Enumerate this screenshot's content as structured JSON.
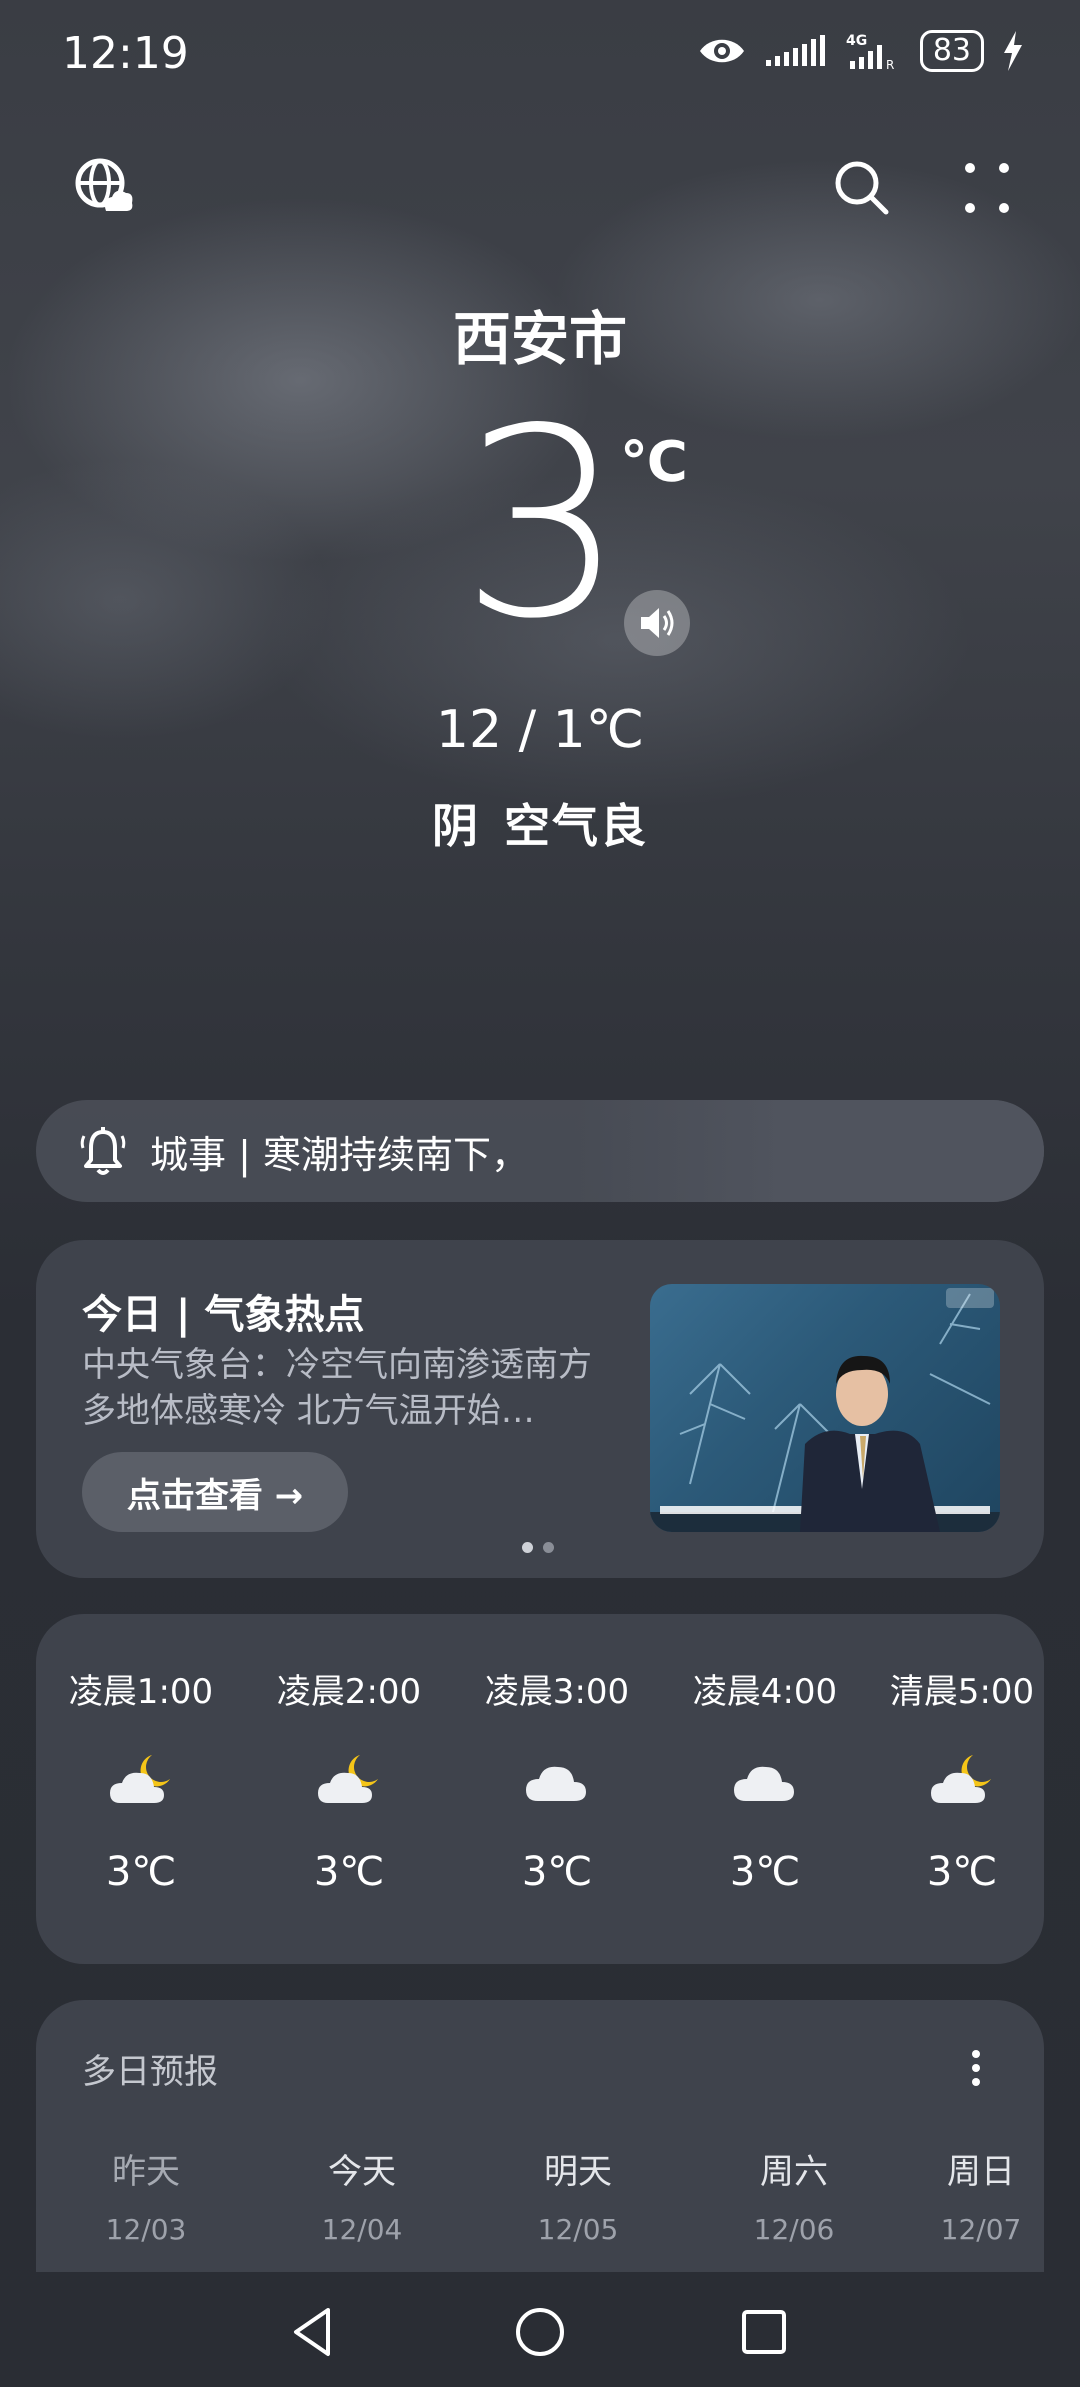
{
  "status_bar": {
    "time": "12:19",
    "battery": "83",
    "network": "4G"
  },
  "header": {
    "city": "西安市",
    "temperature": "3",
    "unit": "℃",
    "range": "12 / 1℃",
    "condition": "阴",
    "air_quality": "空气良"
  },
  "alert": {
    "text": "城事 | 寒潮持续南下，"
  },
  "news": {
    "title": "今日 | 气象热点",
    "description": "中央气象台：冷空气向南渗透南方多地体感寒冷 北方气温开始…",
    "button_label": "点击查看 →",
    "page_count": 2,
    "active_page": 1
  },
  "hourly": [
    {
      "time": "凌晨1:00",
      "icon": "moon-cloud-icon",
      "temp": "3℃"
    },
    {
      "time": "凌晨2:00",
      "icon": "moon-cloud-icon",
      "temp": "3℃"
    },
    {
      "time": "凌晨3:00",
      "icon": "cloud-icon",
      "temp": "3℃"
    },
    {
      "time": "凌晨4:00",
      "icon": "cloud-icon",
      "temp": "3℃"
    },
    {
      "time": "清晨5:00",
      "icon": "moon-cloud-icon",
      "temp": "3℃"
    }
  ],
  "daily": {
    "title": "多日预报",
    "days": [
      {
        "name": "昨天",
        "date": "12/03"
      },
      {
        "name": "今天",
        "date": "12/04"
      },
      {
        "name": "明天",
        "date": "12/05"
      },
      {
        "name": "周六",
        "date": "12/06"
      },
      {
        "name": "周日",
        "date": "12/07"
      }
    ]
  },
  "colors": {
    "card": "#3f434c",
    "moon": "#f5c518",
    "cloud": "#eef0f3"
  }
}
